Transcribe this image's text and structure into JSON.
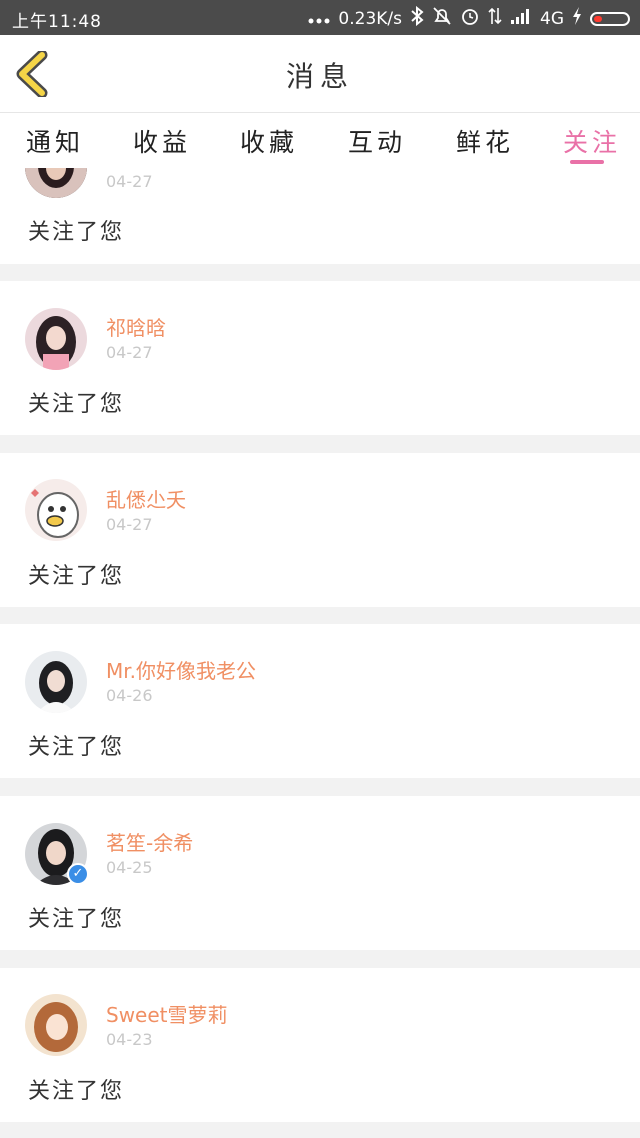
{
  "status_bar": {
    "time": "上午11:48",
    "network_speed": "0.23K/s",
    "signal_label": "4G",
    "icons": [
      "more-dots-icon",
      "bluetooth-icon",
      "mute-icon",
      "alarm-icon",
      "data-arrows-icon",
      "signal-icon",
      "charging-icon",
      "battery-icon"
    ]
  },
  "header": {
    "title": "消息",
    "back_icon": "chevron-left-icon"
  },
  "tabs": [
    {
      "label": "通知",
      "active": false
    },
    {
      "label": "收益",
      "active": false
    },
    {
      "label": "收藏",
      "active": false
    },
    {
      "label": "互动",
      "active": false
    },
    {
      "label": "鲜花",
      "active": false
    },
    {
      "label": "关注",
      "active": true
    }
  ],
  "colors": {
    "accent_pink": "#e971a7",
    "name_orange": "#f08f63",
    "date_gray": "#c8c8c8",
    "divider_bg": "#f2f2f2"
  },
  "items": [
    {
      "name": "",
      "date": "04-27",
      "action": "关注了您"
    },
    {
      "name": "祁晗晗",
      "date": "04-27",
      "action": "关注了您"
    },
    {
      "name": "乱僁尐夭",
      "date": "04-27",
      "action": "关注了您"
    },
    {
      "name": "Mr.你好像我老公",
      "date": "04-26",
      "action": "关注了您"
    },
    {
      "name": "茗笙-余希",
      "date": "04-25",
      "action": "关注了您",
      "verified": true
    },
    {
      "name": "Sweet雪萝莉",
      "date": "04-23",
      "action": "关注了您"
    }
  ]
}
